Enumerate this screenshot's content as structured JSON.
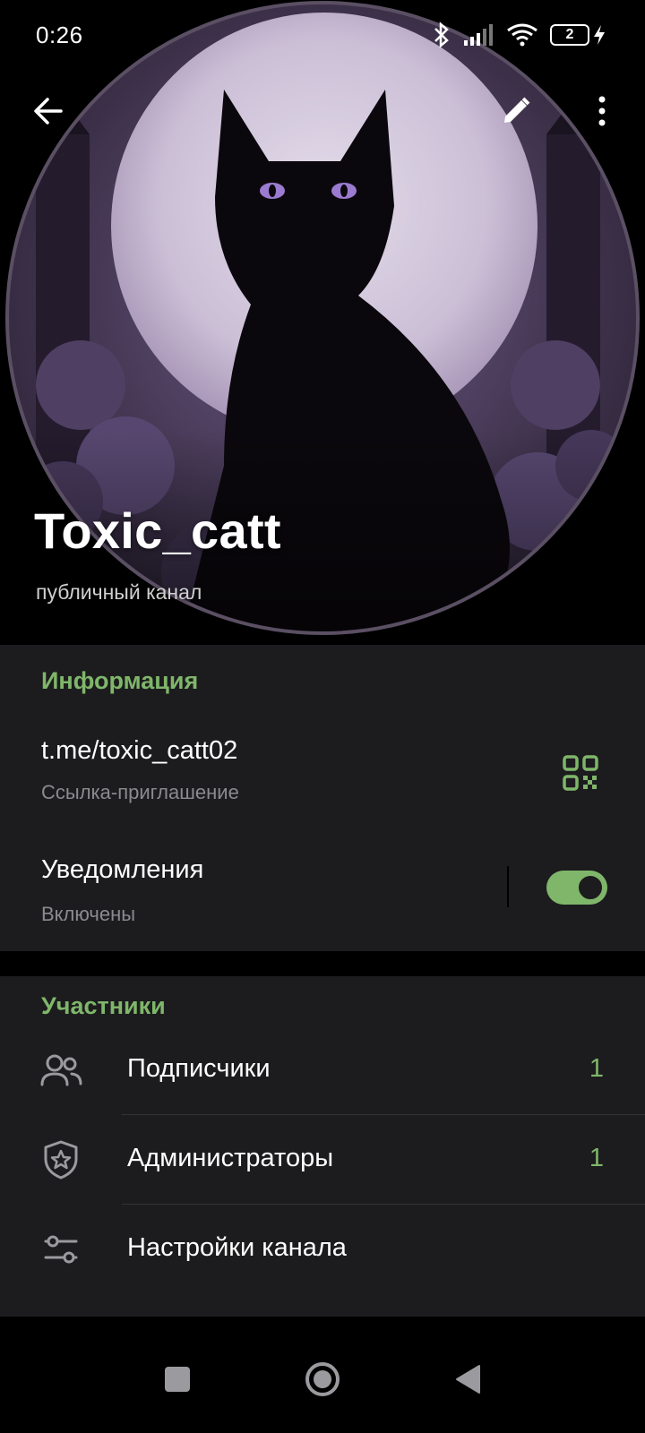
{
  "status_bar": {
    "time": "0:26",
    "battery_level": "2",
    "icons": [
      "bluetooth-icon",
      "signal-icon",
      "wifi-icon",
      "battery-icon",
      "charging-icon"
    ]
  },
  "header": {
    "title": "Toxic_catt",
    "subtitle": "публичный канал",
    "avatar_description_icon": "black-cat-moon-avatar"
  },
  "info": {
    "section_title": "Информация",
    "link_value": "t.me/toxic_catt02",
    "link_label": "Ссылка-приглашение",
    "notifications_title": "Уведомления",
    "notifications_status": "Включены",
    "notifications_enabled": true
  },
  "members": {
    "section_title": "Участники",
    "rows": [
      {
        "label": "Подписчики",
        "count": "1",
        "icon": "people-icon"
      },
      {
        "label": "Администраторы",
        "count": "1",
        "icon": "shield-star-icon"
      },
      {
        "label": "Настройки канала",
        "count": "",
        "icon": "sliders-icon"
      }
    ]
  },
  "colors": {
    "accent": "#7fb66a",
    "card_bg": "#1c1c1e",
    "secondary_text": "#8a8a8f",
    "background": "#000000"
  }
}
